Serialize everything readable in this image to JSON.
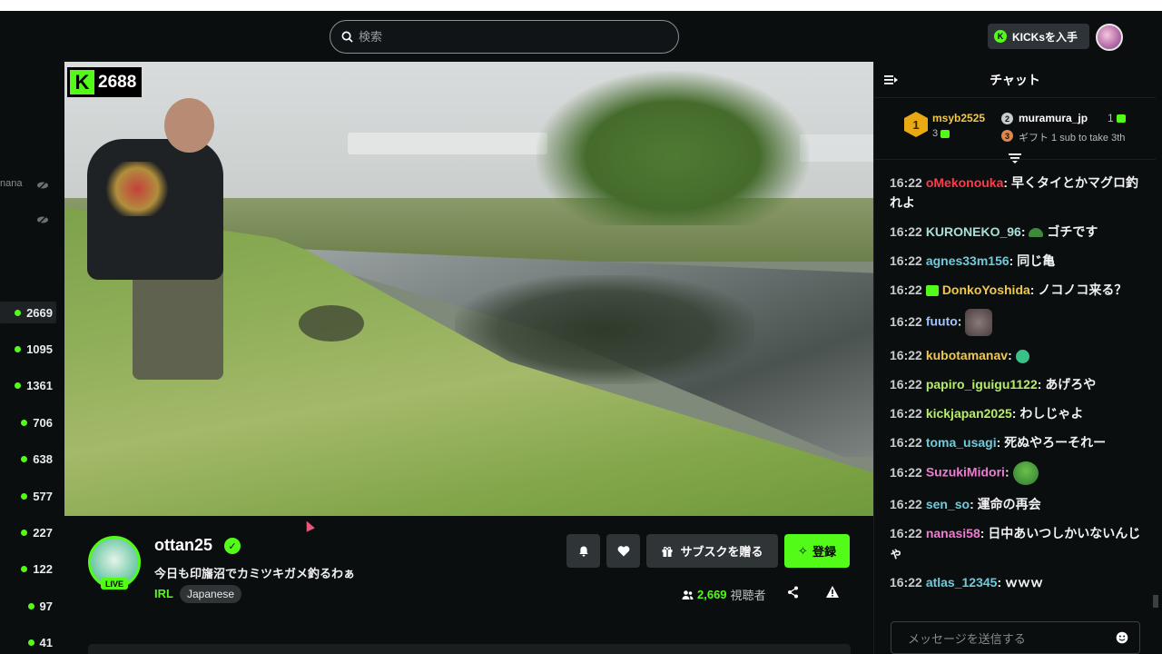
{
  "header": {
    "search_placeholder": "検索",
    "kicks_button": "KICKsを入手"
  },
  "sidebar": {
    "ghost_label": "nana",
    "items": [
      {
        "count": "2669"
      },
      {
        "count": "1095"
      },
      {
        "count": "1361"
      },
      {
        "count": "706"
      },
      {
        "count": "638"
      },
      {
        "count": "577"
      },
      {
        "count": "227"
      },
      {
        "count": "122"
      },
      {
        "count": "97"
      },
      {
        "count": "41"
      }
    ]
  },
  "video": {
    "viewer_count": "2688",
    "logo_letter": "K"
  },
  "stream": {
    "channel_name": "ottan25",
    "live_label": "LIVE",
    "title": "今日も印旛沼でカミツキガメ釣るわぁ",
    "category": "IRL",
    "tag": "Japanese",
    "gift_button": "サブスクを贈る",
    "follow_button": "登録",
    "viewers_count": "2,669",
    "viewers_label": "視聴者"
  },
  "chat": {
    "header": "チャット",
    "pinned": {
      "rank1_user": "msyb2525",
      "rank1_rank": "1",
      "rank1_count": "3",
      "rank2_user": "muramura_jp",
      "rank2_rank": "2",
      "rank2_count": "1",
      "rank3_rank": "3",
      "rank3_text": "ギフト 1 sub to take 3th"
    },
    "messages": [
      {
        "time": "16:22",
        "user": "oMekonouka",
        "color": "#ff3b47",
        "text": "早くタイとかマグロ釣れよ"
      },
      {
        "time": "16:22",
        "user": "KURONEKO_96",
        "color": "#a8e0d8",
        "text": "ゴチです"
      },
      {
        "time": "16:22",
        "user": "agnes33m156",
        "color": "#6fcbdc",
        "text": "同じ亀"
      },
      {
        "time": "16:22",
        "user": "DonkoYoshida",
        "color": "#f0c94a",
        "text": "ノコノコ来る？"
      },
      {
        "time": "16:22",
        "user": "fuuto",
        "color": "#9fc3ff",
        "text": ""
      },
      {
        "time": "16:22",
        "user": "kubotamanav",
        "color": "#f0c94a",
        "text": ""
      },
      {
        "time": "16:22",
        "user": "papiro_iguigu1122",
        "color": "#b6ee6a",
        "text": "あげろや"
      },
      {
        "time": "16:22",
        "user": "kickjapan2025",
        "color": "#b6ee6a",
        "text": "わしじゃよ"
      },
      {
        "time": "16:22",
        "user": "toma_usagi",
        "color": "#6fcbdc",
        "text": "死ぬやろーそれー"
      },
      {
        "time": "16:22",
        "user": "SuzukiMidori",
        "color": "#f07bd0",
        "text": ""
      },
      {
        "time": "16:22",
        "user": "sen_so",
        "color": "#6fcbdc",
        "text": "運命の再会"
      },
      {
        "time": "16:22",
        "user": "nanasi58",
        "color": "#f07bd0",
        "text": "日中あいつしかいないんじゃ"
      },
      {
        "time": "16:22",
        "user": "atlas_12345",
        "color": "#6fcbdc",
        "text": "ｗｗｗ"
      }
    ],
    "input_placeholder": "メッセージを送信する"
  },
  "colors": {
    "accent": "#53fc18",
    "background": "#0b0e0f",
    "button_bg": "#2f3437"
  }
}
